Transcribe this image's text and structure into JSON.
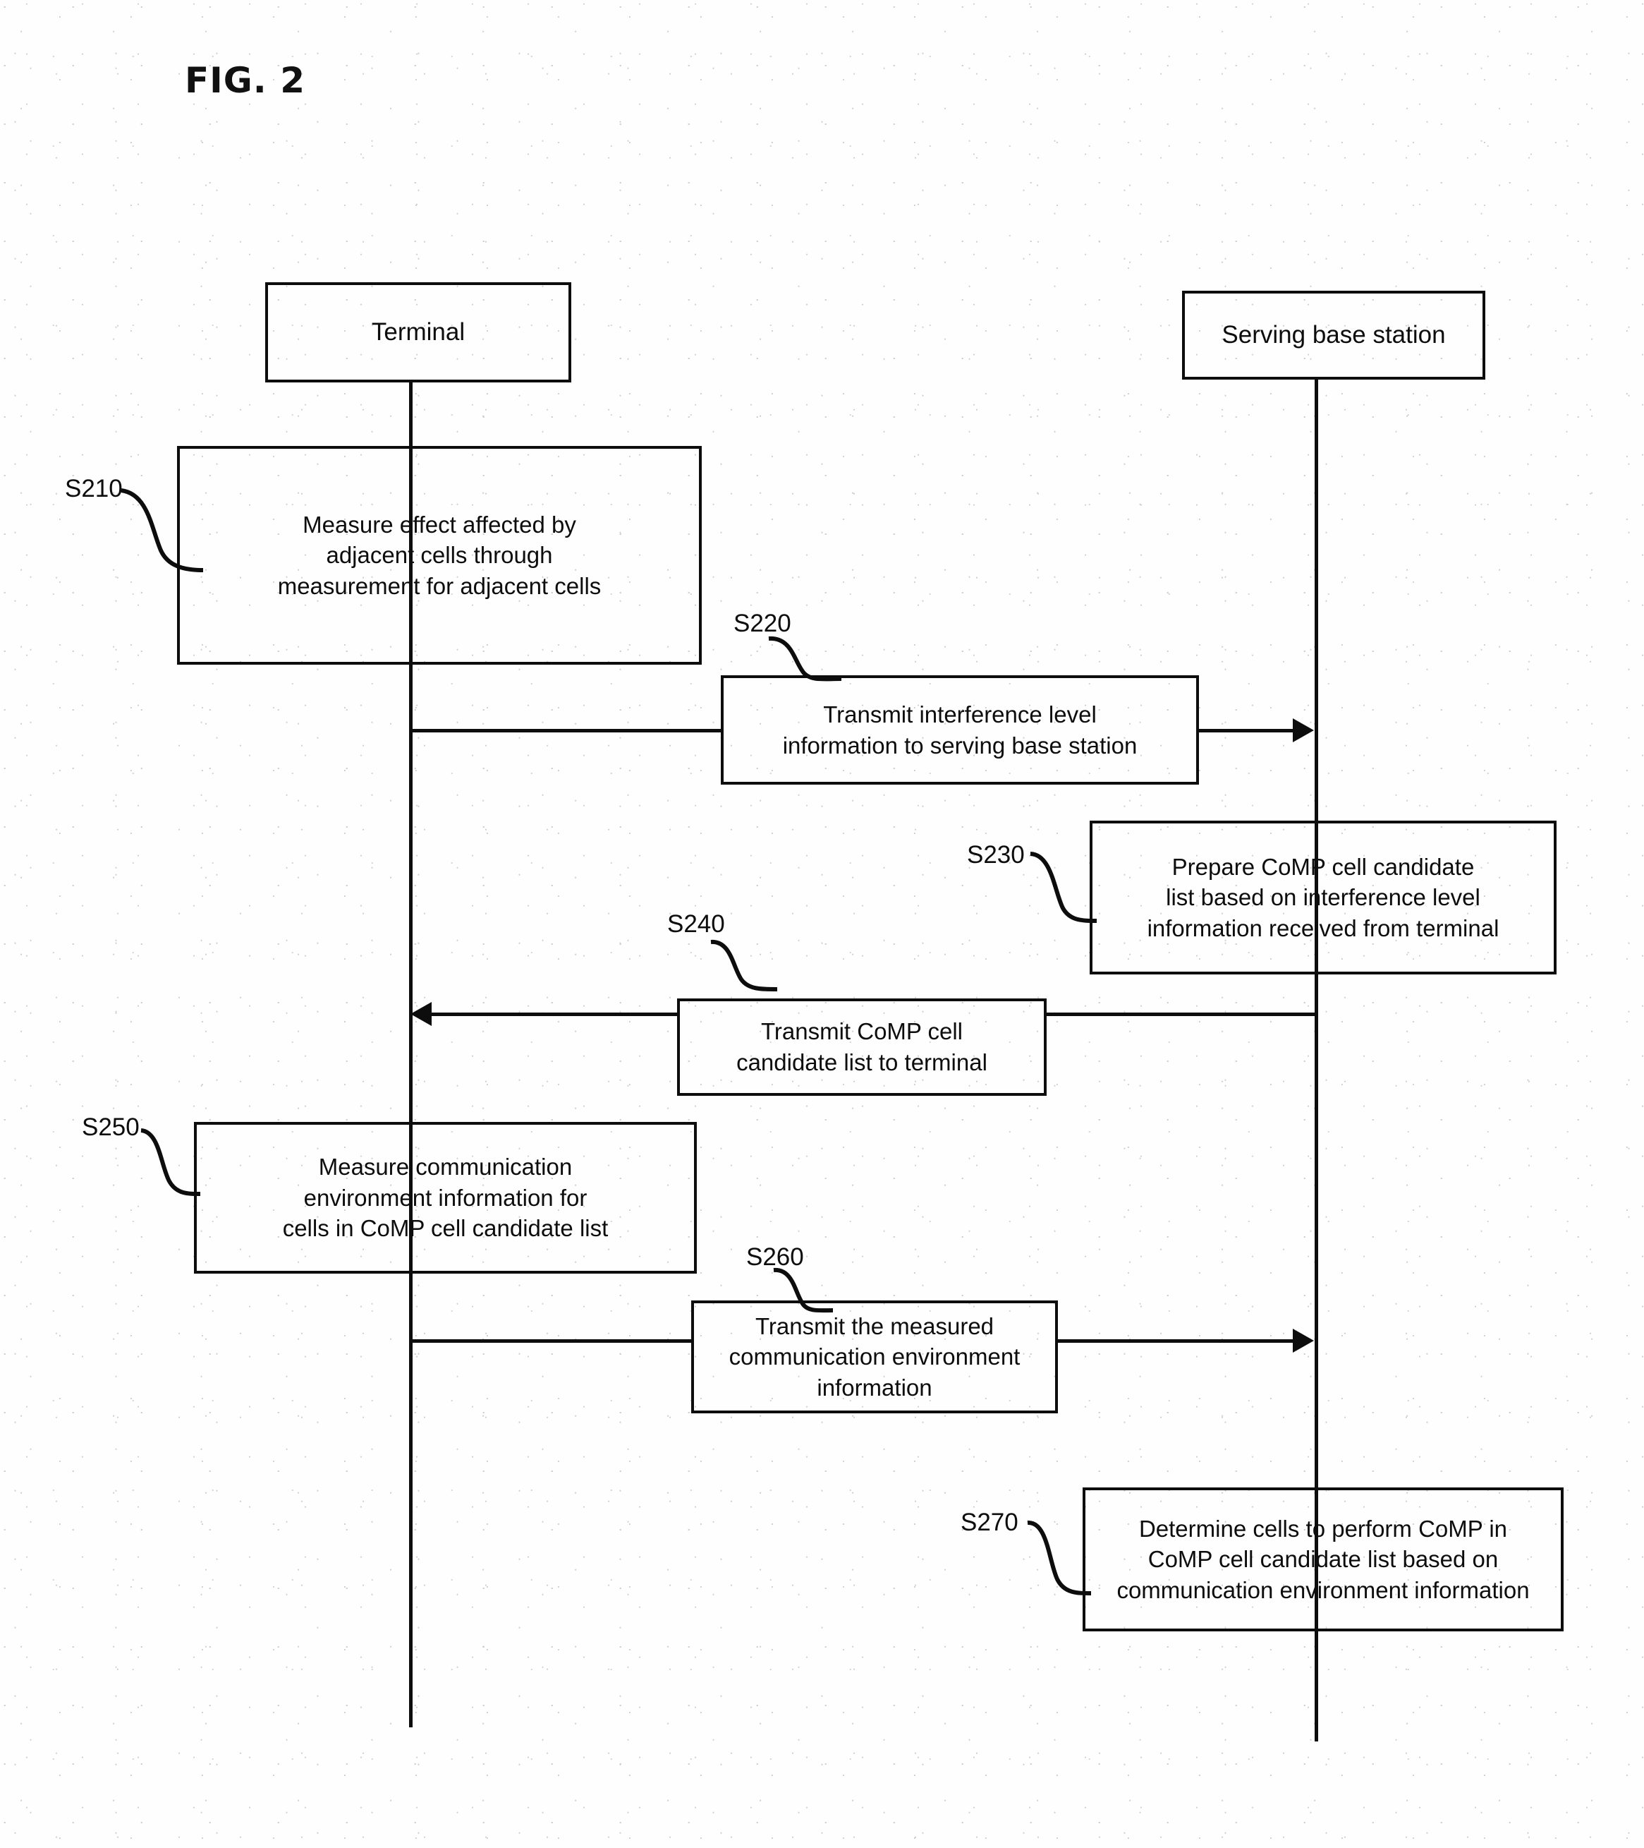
{
  "figure": {
    "title": "FIG. 2"
  },
  "actors": [
    {
      "id": "terminal",
      "label": "Terminal"
    },
    {
      "id": "serving_base_station",
      "label": "Serving base station"
    }
  ],
  "steps": [
    {
      "ref": "S210",
      "lane": "terminal",
      "kind": "process",
      "text": "Measure effect affected by\nadjacent cells through\nmeasurement for adjacent cells"
    },
    {
      "ref": "S220",
      "lane": "terminal-to-serving",
      "kind": "message",
      "text": "Transmit interference level\ninformation to serving base station"
    },
    {
      "ref": "S230",
      "lane": "serving_base_station",
      "kind": "process",
      "text": "Prepare CoMP cell candidate\nlist based on interference level\ninformation received from terminal"
    },
    {
      "ref": "S240",
      "lane": "serving-to-terminal",
      "kind": "message",
      "text": "Transmit CoMP cell\ncandidate list to terminal"
    },
    {
      "ref": "S250",
      "lane": "terminal",
      "kind": "process",
      "text": "Measure communication\nenvironment information for\ncells in CoMP cell candidate list"
    },
    {
      "ref": "S260",
      "lane": "terminal-to-serving",
      "kind": "message",
      "text": "Transmit the measured\ncommunication environment\ninformation"
    },
    {
      "ref": "S270",
      "lane": "serving_base_station",
      "kind": "process",
      "text": "Determine cells to perform CoMP in\nCoMP cell candidate list based on\ncommunication environment information"
    }
  ],
  "colors": {
    "line": "#0d0d0d",
    "background": "#fefefe"
  }
}
